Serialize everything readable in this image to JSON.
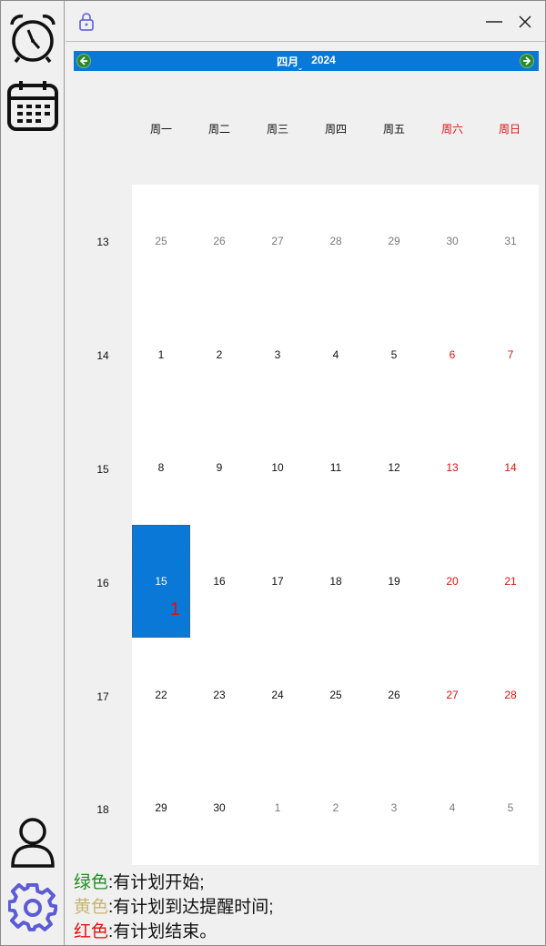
{
  "calendar": {
    "month_label": "四月",
    "year_label": "2024",
    "weekdays": [
      "周一",
      "周二",
      "周三",
      "周四",
      "周五",
      "周六",
      "周日"
    ],
    "week_numbers": [
      "13",
      "14",
      "15",
      "16",
      "17",
      "18"
    ],
    "weeks": [
      [
        "25",
        "26",
        "27",
        "28",
        "29",
        "30",
        "31"
      ],
      [
        "1",
        "2",
        "3",
        "4",
        "5",
        "6",
        "7"
      ],
      [
        "8",
        "9",
        "10",
        "11",
        "12",
        "13",
        "14"
      ],
      [
        "15",
        "16",
        "17",
        "18",
        "19",
        "20",
        "21"
      ],
      [
        "22",
        "23",
        "24",
        "25",
        "26",
        "27",
        "28"
      ],
      [
        "29",
        "30",
        "1",
        "2",
        "3",
        "4",
        "5"
      ]
    ],
    "selected_day": "15",
    "selected_day_badge": "1"
  },
  "legend": {
    "green_label": "绿色",
    "green_text": ":有计划开始;",
    "yellow_label": "黄色",
    "yellow_text": ":有计划到达提醒时间;",
    "red_label": "红色",
    "red_text": ":有计划结束。"
  },
  "icons": {
    "sidebar": [
      "alarm-clock-icon",
      "calendar-icon",
      "user-icon",
      "settings-gear-icon"
    ],
    "titlebar": [
      "lock-icon",
      "minimize-icon",
      "close-icon"
    ]
  },
  "colors": {
    "accent": "#0a78d7",
    "weekend": "#e01010",
    "legend_green": "#1f8f1f",
    "legend_yellow": "#c8b46e",
    "legend_red": "#e01010",
    "gear": "#5b5bd6"
  }
}
